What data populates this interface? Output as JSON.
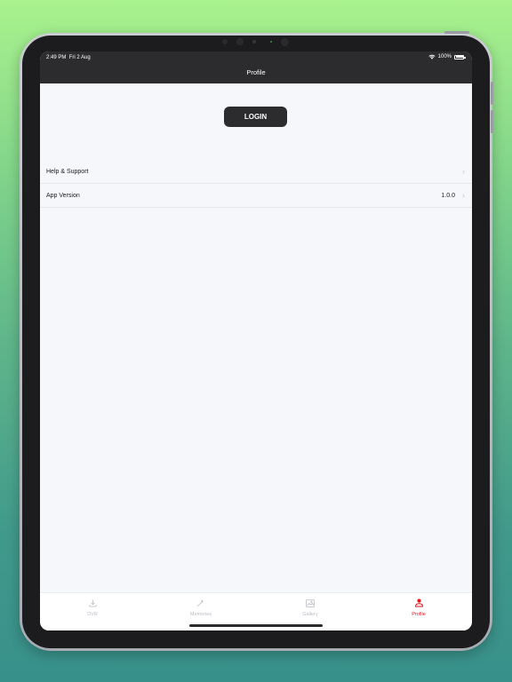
{
  "status_bar": {
    "time": "2:49 PM",
    "date": "Fri 2 Aug",
    "battery": "100%"
  },
  "header": {
    "title": "Profile"
  },
  "login": {
    "label": "LOGIN"
  },
  "list": [
    {
      "label": "Help & Support",
      "value": ""
    },
    {
      "label": "App Version",
      "value": "1.0.0"
    }
  ],
  "tabs": [
    {
      "label": "DVR",
      "icon": "download-icon",
      "active": false
    },
    {
      "label": "Memories",
      "icon": "memories-icon",
      "active": false
    },
    {
      "label": "Gallery",
      "icon": "gallery-icon",
      "active": false
    },
    {
      "label": "Profile",
      "icon": "profile-icon",
      "active": true
    }
  ],
  "colors": {
    "accent": "#e0101b",
    "nav": "#2c2c2e",
    "background": "#f6f7fb",
    "inactive": "#b8bcc4"
  }
}
